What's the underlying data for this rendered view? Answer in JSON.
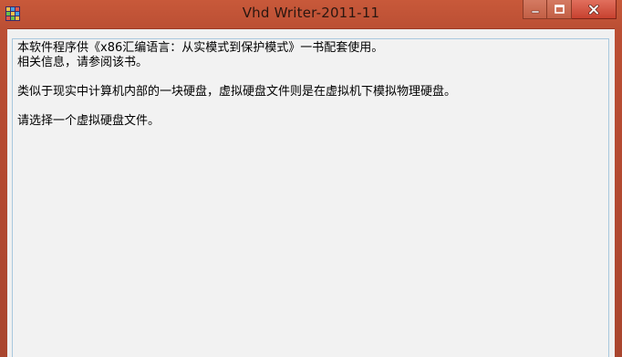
{
  "window": {
    "title": "Vhd Writer-2011-11",
    "app_icon": "app-grid-icon"
  },
  "controls": {
    "minimize_icon": "minimize-icon",
    "maximize_icon": "maximize-icon",
    "close_icon": "close-icon"
  },
  "content": {
    "lines": [
      "本软件程序供《x86汇编语言：从实模式到保护模式》一书配套使用。",
      "相关信息，请参阅该书。",
      "",
      "类似于现实中计算机内部的一块硬盘，虚拟硬盘文件则是在虚拟机下模拟物理硬盘。",
      "",
      "请选择一个虚拟硬盘文件。"
    ]
  },
  "colors": {
    "frame": "#b54a31",
    "close_button": "#c7412f",
    "client_bg": "#f0f0f0",
    "textbox_border": "#a9c8de"
  }
}
